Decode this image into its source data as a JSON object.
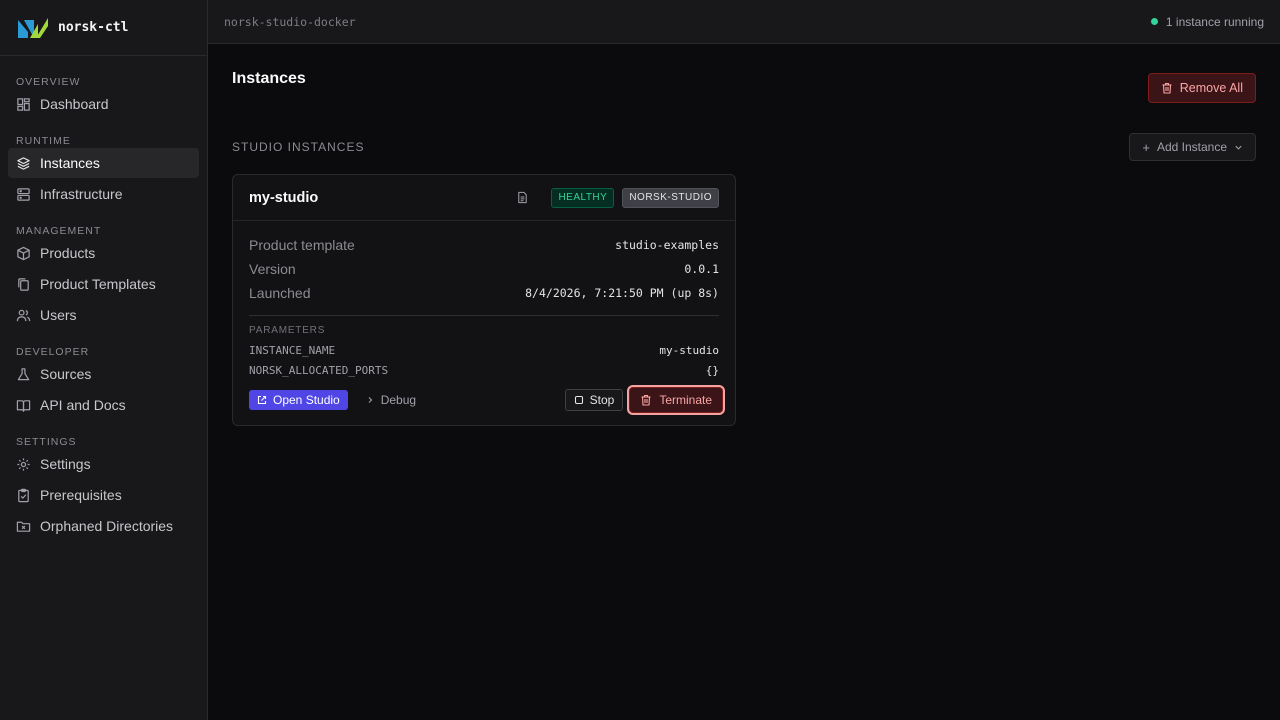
{
  "app": {
    "name": "norsk-ctl"
  },
  "colors": {
    "accent": "#4f46e5",
    "success": "#34d399",
    "danger": "#fca5a5",
    "brand_blue": "#2b9bd6",
    "brand_green": "#a3d93a"
  },
  "sidebar": {
    "sections": [
      {
        "label": "OVERVIEW",
        "items": [
          {
            "label": "Dashboard",
            "icon": "grid-icon"
          }
        ]
      },
      {
        "label": "RUNTIME",
        "items": [
          {
            "label": "Instances",
            "icon": "layers-icon",
            "active": true
          },
          {
            "label": "Infrastructure",
            "icon": "server-icon"
          }
        ]
      },
      {
        "label": "MANAGEMENT",
        "items": [
          {
            "label": "Products",
            "icon": "box-icon"
          },
          {
            "label": "Product Templates",
            "icon": "copy-icon"
          },
          {
            "label": "Users",
            "icon": "users-icon"
          }
        ]
      },
      {
        "label": "DEVELOPER",
        "items": [
          {
            "label": "Sources",
            "icon": "flask-icon"
          },
          {
            "label": "API and Docs",
            "icon": "book-icon"
          }
        ]
      },
      {
        "label": "SETTINGS",
        "items": [
          {
            "label": "Settings",
            "icon": "gear-icon"
          },
          {
            "label": "Prerequisites",
            "icon": "clipboard-check-icon"
          },
          {
            "label": "Orphaned Directories",
            "icon": "folder-x-icon"
          }
        ]
      }
    ]
  },
  "topbar": {
    "context": "norsk-studio-docker",
    "status": "1 instance running"
  },
  "main": {
    "title": "Instances",
    "remove_all_label": "Remove All",
    "section_label": "STUDIO INSTANCES",
    "add_instance_label": "Add Instance"
  },
  "instance": {
    "name": "my-studio",
    "health": "HEALTHY",
    "type": "NORSK-STUDIO",
    "fields": [
      {
        "label": "Product template",
        "value": "studio-examples"
      },
      {
        "label": "Version",
        "value": "0.0.1"
      },
      {
        "label": "Launched",
        "value": "8/4/2026, 7:21:50 PM (up 8s)"
      }
    ],
    "params_label": "PARAMETERS",
    "params": [
      {
        "key": "INSTANCE_NAME",
        "value": "my-studio"
      },
      {
        "key": "NORSK_ALLOCATED_PORTS",
        "value": "{}"
      }
    ],
    "actions": {
      "open": "Open Studio",
      "debug": "Debug",
      "stop": "Stop",
      "terminate": "Terminate"
    }
  }
}
